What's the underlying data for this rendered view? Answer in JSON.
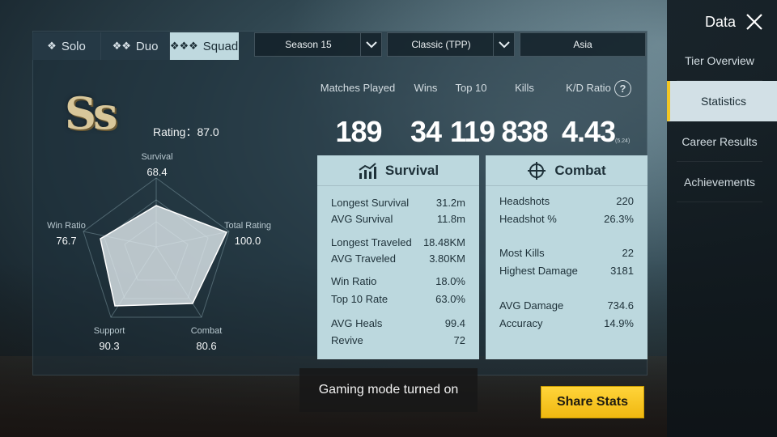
{
  "mode_tabs": [
    {
      "label": "Solo",
      "icon": "solo-icon",
      "active": false
    },
    {
      "label": "Duo",
      "icon": "duo-icon",
      "active": false
    },
    {
      "label": "Squad",
      "icon": "squad-icon",
      "active": true
    }
  ],
  "filters": {
    "season": "Season 15",
    "mode": "Classic (TPP)",
    "region": "Asia"
  },
  "tier": {
    "badge": "Ss",
    "rating_text": "Rating：87.0"
  },
  "radar": {
    "axes": [
      {
        "label": "Survival",
        "value": "68.4"
      },
      {
        "label": "Total Rating",
        "value": "100.0"
      },
      {
        "label": "Combat",
        "value": "80.6"
      },
      {
        "label": "Support",
        "value": "90.3"
      },
      {
        "label": "Win Ratio",
        "value": "76.7"
      }
    ]
  },
  "summary": {
    "headers": [
      "Matches Played",
      "Wins",
      "Top 10",
      "Kills",
      "K/D Ratio"
    ],
    "values": [
      "189",
      "34",
      "119",
      "838",
      "4.43"
    ],
    "kd_sub": "(5.24)"
  },
  "survival_card": {
    "title": "Survival",
    "rows": [
      {
        "k": "Longest Survival",
        "v": "31.2m"
      },
      {
        "k": "AVG Survival",
        "v": "11.8m"
      },
      {
        "k": "Longest Traveled",
        "v": "18.48KM"
      },
      {
        "k": "AVG Traveled",
        "v": "3.80KM"
      },
      {
        "k": "Win Ratio",
        "v": "18.0%"
      },
      {
        "k": "Top 10 Rate",
        "v": "63.0%"
      },
      {
        "k": "AVG Heals",
        "v": "99.4"
      },
      {
        "k": "Revive",
        "v": "72"
      }
    ]
  },
  "combat_card": {
    "title": "Combat",
    "rows": [
      {
        "k": "Headshots",
        "v": "220"
      },
      {
        "k": "Headshot %",
        "v": "26.3%"
      },
      {
        "k": "Most Kills",
        "v": "22"
      },
      {
        "k": "Highest Damage",
        "v": "3181"
      },
      {
        "k": "AVG Damage",
        "v": "734.6"
      },
      {
        "k": "Accuracy",
        "v": "14.9%"
      }
    ]
  },
  "sidebar": {
    "title": "Data",
    "items": [
      {
        "label": "Tier Overview",
        "active": false
      },
      {
        "label": "Statistics",
        "active": true
      },
      {
        "label": "Career Results",
        "active": false
      },
      {
        "label": "Achievements",
        "active": false
      }
    ]
  },
  "toast": "Gaming mode turned on",
  "share_button": "Share Stats",
  "colors": {
    "accent": "#f2c624",
    "card_bg": "#bcd8de",
    "active_tab": "#bfd9df"
  }
}
